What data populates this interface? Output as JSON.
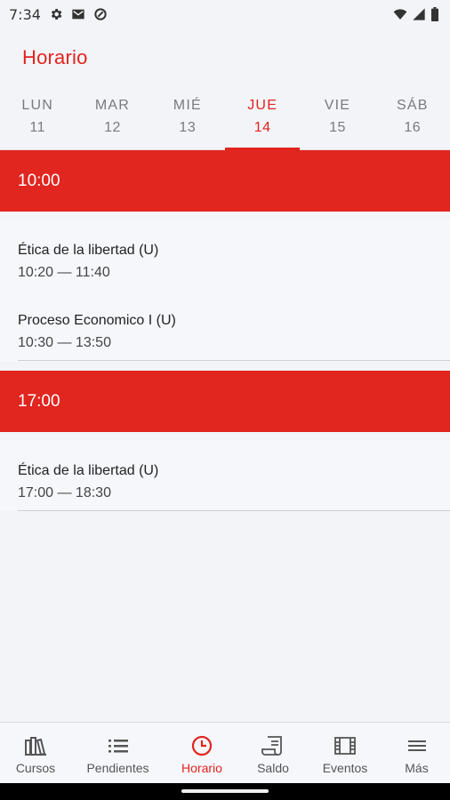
{
  "status_bar": {
    "time": "7:34",
    "left_icons": [
      "gear-icon",
      "gmail-icon",
      "data-saver-icon"
    ],
    "right_icons": [
      "wifi-icon",
      "signal-icon",
      "battery-icon"
    ]
  },
  "header": {
    "title": "Horario"
  },
  "days": [
    {
      "name": "LUN",
      "num": "11",
      "active": false
    },
    {
      "name": "MAR",
      "num": "12",
      "active": false
    },
    {
      "name": "MIÉ",
      "num": "13",
      "active": false
    },
    {
      "name": "JUE",
      "num": "14",
      "active": true
    },
    {
      "name": "VIE",
      "num": "15",
      "active": false
    },
    {
      "name": "SÁB",
      "num": "16",
      "active": false
    }
  ],
  "schedule": [
    {
      "time": "10:00",
      "classes": [
        {
          "name": "Ética de la libertad (U)",
          "time": "10:20 — 11:40"
        },
        {
          "name": "Proceso Economico I (U)",
          "time": "10:30 — 13:50"
        }
      ]
    },
    {
      "time": "17:00",
      "classes": [
        {
          "name": "Ética de la libertad (U)",
          "time": "17:00 — 18:30"
        }
      ]
    }
  ],
  "bottom_nav": [
    {
      "label": "Cursos",
      "icon": "books-icon",
      "active": false
    },
    {
      "label": "Pendientes",
      "icon": "list-icon",
      "active": false
    },
    {
      "label": "Horario",
      "icon": "clock-icon",
      "active": true
    },
    {
      "label": "Saldo",
      "icon": "receipt-icon",
      "active": false
    },
    {
      "label": "Eventos",
      "icon": "film-icon",
      "active": false
    },
    {
      "label": "Más",
      "icon": "menu-icon",
      "active": false
    }
  ],
  "colors": {
    "accent": "#e2231f",
    "background": "#f3f4f8"
  }
}
